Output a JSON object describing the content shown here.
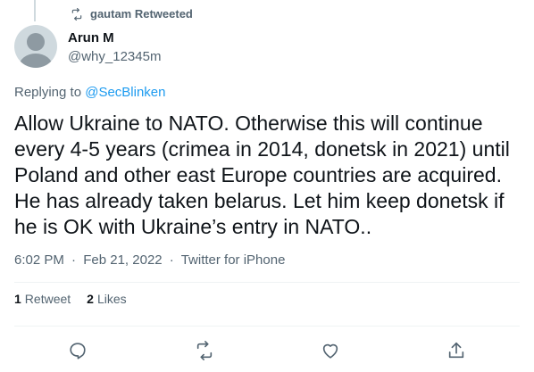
{
  "social_context": {
    "text": "gautam Retweeted",
    "icon": "retweet-icon"
  },
  "author": {
    "name": "Arun M",
    "handle": "@why_12345m"
  },
  "replying": {
    "prefix": "Replying to ",
    "mention": "@SecBlinken"
  },
  "tweet": {
    "text": "Allow Ukraine to NATO. Otherwise this will continue\nevery 4-5 years (crimea in 2014, donetsk in 2021) until\nPoland and other east Europe countries are acquired.\nHe has already taken belarus. Let him keep donetsk if\nhe is OK with Ukraine’s entry in NATO.."
  },
  "meta": {
    "time": "6:02 PM",
    "date": "Feb 21, 2022",
    "source": "Twitter for iPhone",
    "separator": "·"
  },
  "stats": {
    "retweets_count": "1",
    "retweets_label": "Retweet",
    "likes_count": "2",
    "likes_label": "Likes"
  },
  "actions": {
    "reply": "reply-icon",
    "retweet": "retweet-icon",
    "like": "heart-icon",
    "share": "share-icon"
  },
  "colors": {
    "text": "#0f1419",
    "secondary": "#536471",
    "accent": "#1d9bf0",
    "divider": "#eff3f4"
  }
}
